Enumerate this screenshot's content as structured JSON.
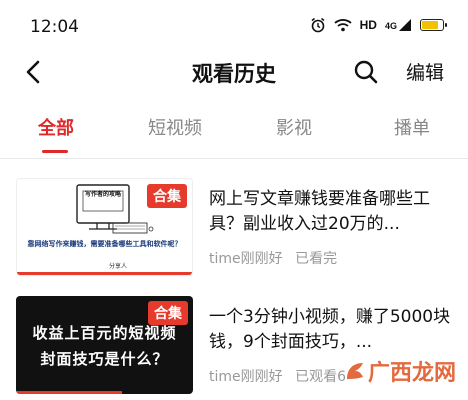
{
  "status": {
    "time": "12:04",
    "hd": "HD",
    "network": "4G",
    "battery_level": 0.8
  },
  "header": {
    "title": "观看历史",
    "edit_label": "编辑"
  },
  "tabs": [
    {
      "label": "全部",
      "active": true
    },
    {
      "label": "短视频",
      "active": false
    },
    {
      "label": "影视",
      "active": false
    },
    {
      "label": "播单",
      "active": false
    }
  ],
  "items": [
    {
      "badge": "合集",
      "title": "网上写文章赚钱要准备哪些工具？副业收入过20万的...",
      "author": "time刚刚好",
      "status": "已看完",
      "thumb_heading": "写作者的攻略",
      "thumb_caption": "靠网络写作来赚钱，需要准备哪些工具和软件呢？",
      "thumb_footer": "分享人",
      "progress": 1.0
    },
    {
      "badge": "合集",
      "title": "一个3分钟小视频，赚了5000块钱，9个封面技巧，...",
      "author": "time刚刚好",
      "status": "已观看6",
      "thumb_line1": "收益上百元的短视频",
      "thumb_line2": "封面技巧是什么？",
      "progress": 0.6
    }
  ],
  "watermark": {
    "text": "广西龙网"
  },
  "colors": {
    "accent": "#e0282a",
    "badge": "#e53a2c",
    "battery": "#f2c200"
  }
}
